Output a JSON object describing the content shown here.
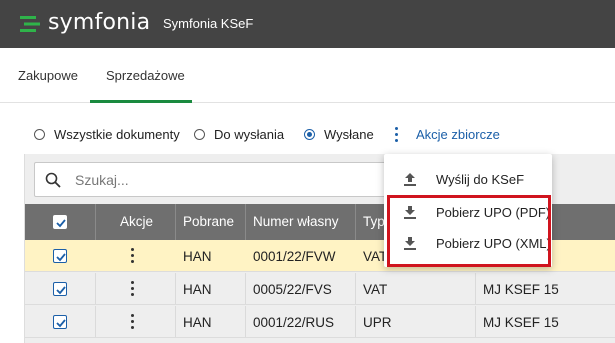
{
  "header": {
    "logo_text": "symfonia",
    "app_title": "Symfonia KSeF",
    "brand_color": "#2fb34a",
    "bar_color": "#444444"
  },
  "tabs": [
    {
      "label": "Zakupowe",
      "active": false
    },
    {
      "label": "Sprzedażowe",
      "active": true
    }
  ],
  "filters": {
    "options": [
      {
        "label": "Wszystkie dokumenty",
        "checked": false
      },
      {
        "label": "Do wysłania",
        "checked": false
      },
      {
        "label": "Wysłane",
        "checked": true
      }
    ],
    "bulk_actions_label": "Akcje zbiorcze"
  },
  "search": {
    "placeholder": "Szukaj..."
  },
  "table": {
    "columns": [
      "",
      "Akcje",
      "Pobrane",
      "Numer własny",
      "Typ",
      ""
    ],
    "rows": [
      {
        "checked": true,
        "pobrane": "HAN",
        "numer": "0001/22/FVW",
        "typ": "VAT",
        "extra": "",
        "selected": true
      },
      {
        "checked": true,
        "pobrane": "HAN",
        "numer": "0005/22/FVS",
        "typ": "VAT",
        "extra": "MJ KSEF 15",
        "selected": false
      },
      {
        "checked": true,
        "pobrane": "HAN",
        "numer": "0001/22/RUS",
        "typ": "UPR",
        "extra": "MJ KSEF 15",
        "selected": false
      }
    ]
  },
  "dropdown": {
    "items": [
      {
        "label": "Wyślij do KSeF",
        "icon": "upload-icon"
      },
      {
        "label": "Pobierz UPO (PDF)",
        "icon": "download-icon"
      },
      {
        "label": "Pobierz UPO (XML)",
        "icon": "download-icon"
      }
    ],
    "highlight_color": "#d0141e"
  },
  "accent_color": "#1b5fa8"
}
